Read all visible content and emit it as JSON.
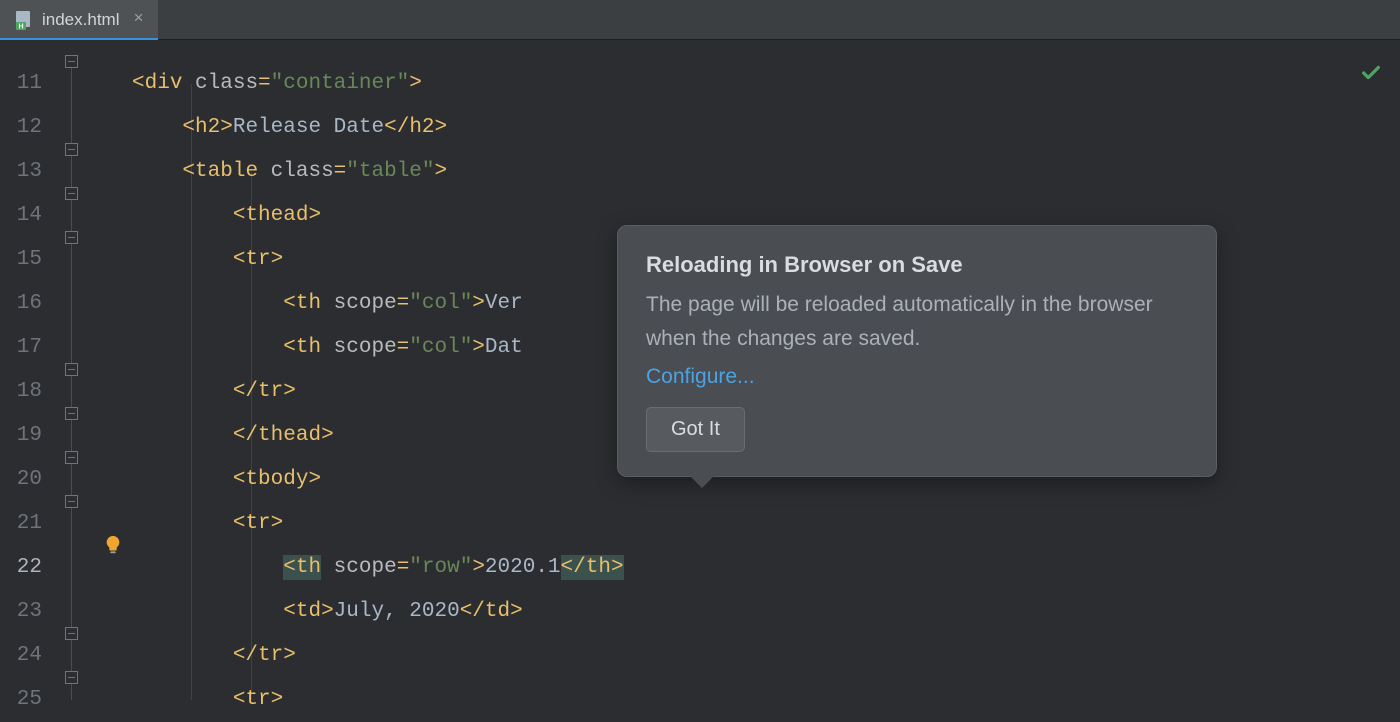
{
  "tab": {
    "filename": "index.html"
  },
  "gutter": {
    "start": 11,
    "count": 15,
    "active": 22
  },
  "code": {
    "lines": [
      {
        "indent": 0,
        "segs": [
          [
            "brk",
            "<"
          ],
          [
            "tag",
            "div "
          ],
          [
            "attr",
            "class"
          ],
          [
            "brk",
            "="
          ],
          [
            "str",
            "\"container\""
          ],
          [
            "brk",
            ">"
          ]
        ],
        "fold": true
      },
      {
        "indent": 1,
        "segs": [
          [
            "brk",
            "<"
          ],
          [
            "tag",
            "h2"
          ],
          [
            "brk",
            ">"
          ],
          [
            "txt",
            "Release Date"
          ],
          [
            "brk",
            "</"
          ],
          [
            "tag",
            "h2"
          ],
          [
            "brk",
            ">"
          ]
        ]
      },
      {
        "indent": 1,
        "segs": [
          [
            "brk",
            "<"
          ],
          [
            "tag",
            "table "
          ],
          [
            "attr",
            "class"
          ],
          [
            "brk",
            "="
          ],
          [
            "str",
            "\"table\""
          ],
          [
            "brk",
            ">"
          ]
        ],
        "fold": true
      },
      {
        "indent": 2,
        "segs": [
          [
            "brk",
            "<"
          ],
          [
            "tag",
            "thead"
          ],
          [
            "brk",
            ">"
          ]
        ],
        "fold": true
      },
      {
        "indent": 2,
        "segs": [
          [
            "brk",
            "<"
          ],
          [
            "tag",
            "tr"
          ],
          [
            "brk",
            ">"
          ]
        ],
        "fold": true
      },
      {
        "indent": 3,
        "segs": [
          [
            "brk",
            "<"
          ],
          [
            "tag",
            "th "
          ],
          [
            "attr",
            "scope"
          ],
          [
            "brk",
            "="
          ],
          [
            "str",
            "\"col\""
          ],
          [
            "brk",
            ">"
          ],
          [
            "txt",
            "Ver"
          ]
        ]
      },
      {
        "indent": 3,
        "segs": [
          [
            "brk",
            "<"
          ],
          [
            "tag",
            "th "
          ],
          [
            "attr",
            "scope"
          ],
          [
            "brk",
            "="
          ],
          [
            "str",
            "\"col\""
          ],
          [
            "brk",
            ">"
          ],
          [
            "txt",
            "Dat"
          ]
        ]
      },
      {
        "indent": 2,
        "segs": [
          [
            "brk",
            "</"
          ],
          [
            "tag",
            "tr"
          ],
          [
            "brk",
            ">"
          ]
        ],
        "fold": true
      },
      {
        "indent": 2,
        "segs": [
          [
            "brk",
            "</"
          ],
          [
            "tag",
            "thead"
          ],
          [
            "brk",
            ">"
          ]
        ],
        "fold": true
      },
      {
        "indent": 2,
        "segs": [
          [
            "brk",
            "<"
          ],
          [
            "tag",
            "tbody"
          ],
          [
            "brk",
            ">"
          ]
        ],
        "fold": true
      },
      {
        "indent": 2,
        "segs": [
          [
            "brk",
            "<"
          ],
          [
            "tag",
            "tr"
          ],
          [
            "brk",
            ">"
          ]
        ],
        "fold": true
      },
      {
        "indent": 3,
        "selected": true,
        "segs": [
          [
            "brkM",
            "<"
          ],
          [
            "tagM",
            "th"
          ],
          [
            "brk",
            " "
          ],
          [
            "attr",
            "scope"
          ],
          [
            "brk",
            "="
          ],
          [
            "str",
            "\"row\""
          ],
          [
            "brk",
            ">"
          ],
          [
            "txt",
            "2020.1"
          ],
          [
            "brkM",
            "</"
          ],
          [
            "tagM",
            "th"
          ],
          [
            "brkM",
            ">"
          ]
        ]
      },
      {
        "indent": 3,
        "segs": [
          [
            "brk",
            "<"
          ],
          [
            "tag",
            "td"
          ],
          [
            "brk",
            ">"
          ],
          [
            "txt",
            "July, 2020"
          ],
          [
            "brk",
            "</"
          ],
          [
            "tag",
            "td"
          ],
          [
            "brk",
            ">"
          ]
        ]
      },
      {
        "indent": 2,
        "segs": [
          [
            "brk",
            "</"
          ],
          [
            "tag",
            "tr"
          ],
          [
            "brk",
            ">"
          ]
        ],
        "fold": true
      },
      {
        "indent": 2,
        "segs": [
          [
            "brk",
            "<"
          ],
          [
            "tag",
            "tr"
          ],
          [
            "brk",
            ">"
          ]
        ],
        "fold": true
      }
    ]
  },
  "tooltip": {
    "title": "Reloading in Browser on Save",
    "body": "The page will be reloaded automatically in the browser when the changes are saved.",
    "link": "Configure...",
    "button": "Got It"
  }
}
